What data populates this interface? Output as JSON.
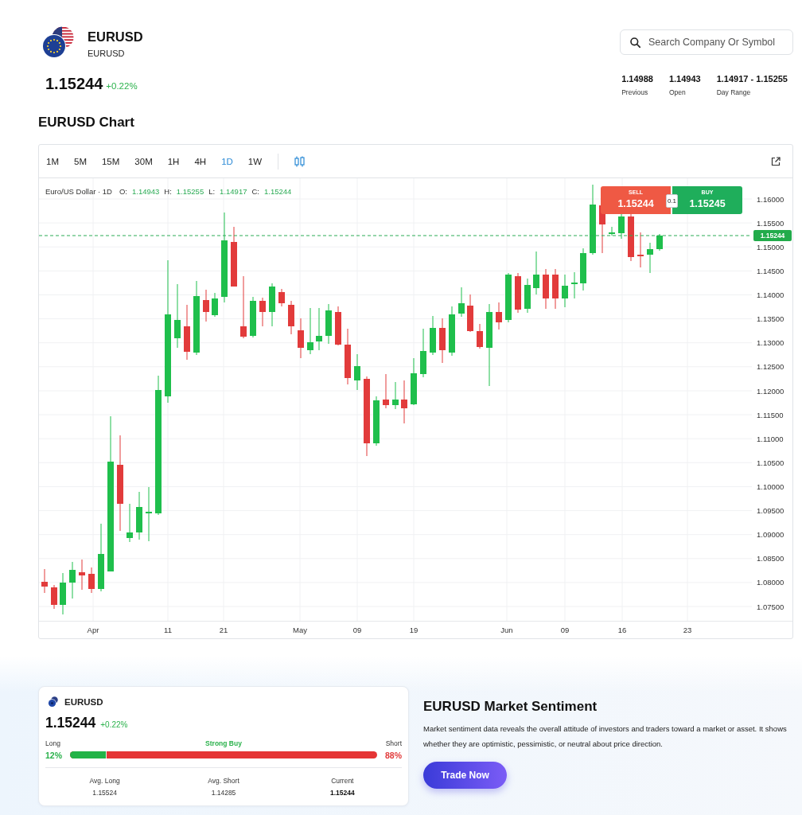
{
  "instrument": {
    "symbol": "EURUSD",
    "subtitle": "EURUSD",
    "price": "1.15244",
    "change": "+0.22%"
  },
  "search": {
    "placeholder": "Search Company Or Symbol"
  },
  "stats": [
    {
      "value": "1.14988",
      "label": "Previous"
    },
    {
      "value": "1.14943",
      "label": "Open"
    },
    {
      "value": "1.14917 - 1.15255",
      "label": "Day Range"
    }
  ],
  "chart_section": {
    "title": "EURUSD Chart",
    "timeframes": [
      {
        "label": "1M",
        "selected": false
      },
      {
        "label": "5M",
        "selected": false
      },
      {
        "label": "15M",
        "selected": false
      },
      {
        "label": "30M",
        "selected": false
      },
      {
        "label": "1H",
        "selected": false
      },
      {
        "label": "4H",
        "selected": false
      },
      {
        "label": "1D",
        "selected": true
      },
      {
        "label": "1W",
        "selected": false
      }
    ],
    "legend": {
      "title": "Euro/US Dollar · 1D",
      "values": [
        {
          "key": "O:",
          "value": "1.14943"
        },
        {
          "key": "H:",
          "value": "1.15255"
        },
        {
          "key": "L:",
          "value": "1.14917"
        },
        {
          "key": "C:",
          "value": "1.15244"
        }
      ]
    },
    "trade_widget": {
      "sell_label": "SELL",
      "sell_price": "1.15244",
      "quantity": "0.1",
      "buy_label": "BUY",
      "buy_price": "1.15245"
    },
    "last_price_label": "1.15244",
    "price_axis": [
      "1.16000",
      "1.15500",
      "1.15000",
      "1.14500",
      "1.14000",
      "1.13500",
      "1.13000",
      "1.12500",
      "1.12000",
      "1.11500",
      "1.11000",
      "1.10500",
      "1.10000",
      "1.09500",
      "1.09000",
      "1.08500",
      "1.08000",
      "1.07500"
    ],
    "date_axis": [
      "Apr",
      "11",
      "21",
      "May",
      "09",
      "19",
      "Jun",
      "09",
      "16",
      "23"
    ]
  },
  "sentiment_card": {
    "symbol": "EURUSD",
    "price": "1.15244",
    "change": "+0.22%",
    "long_label": "Long",
    "long_value": "12%",
    "signal": "Strong Buy",
    "short_label": "Short",
    "short_value": "88%",
    "level": 0.12,
    "stats": [
      {
        "label": "Avg. Long",
        "value": "1.15524",
        "highlighted": false
      },
      {
        "label": "Avg. Short",
        "value": "1.14285",
        "highlighted": false
      },
      {
        "label": "Current",
        "value": "1.15244",
        "highlighted": true
      }
    ]
  },
  "sentiment_info": {
    "title": "EURUSD Market Sentiment",
    "text": "Market sentiment data reveals the overall attitude of investors and traders toward a market or asset. It shows whether they are optimistic, pessimistic, or neutral about price direction.",
    "button": "Trade Now"
  }
}
